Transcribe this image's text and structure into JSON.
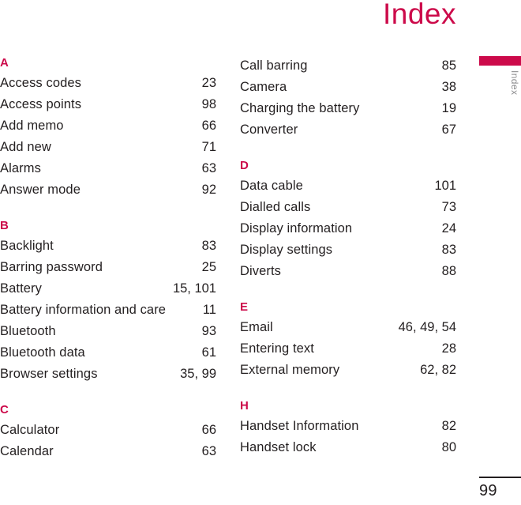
{
  "header": {
    "title": "Index"
  },
  "side_tab": {
    "label": "Index",
    "bar_color": "#cc0a4a",
    "label_color": "#8e8e90"
  },
  "footer": {
    "page_number": "99"
  },
  "theme": {
    "accent": "#cc0a4a",
    "text": "#231f20"
  },
  "columns": [
    {
      "sections": [
        {
          "letter": "A",
          "entries": [
            {
              "label": "Access codes",
              "pages": "23"
            },
            {
              "label": "Access points",
              "pages": "98"
            },
            {
              "label": "Add memo",
              "pages": "66"
            },
            {
              "label": "Add new",
              "pages": "71"
            },
            {
              "label": "Alarms",
              "pages": "63"
            },
            {
              "label": "Answer mode",
              "pages": "92"
            }
          ]
        },
        {
          "letter": "B",
          "entries": [
            {
              "label": "Backlight",
              "pages": "83"
            },
            {
              "label": "Barring password",
              "pages": "25"
            },
            {
              "label": "Battery",
              "pages": "15, 101"
            },
            {
              "label": "Battery information and care",
              "pages": "11"
            },
            {
              "label": "Bluetooth",
              "pages": "93"
            },
            {
              "label": "Bluetooth data",
              "pages": "61"
            },
            {
              "label": "Browser settings",
              "pages": "35, 99"
            }
          ]
        },
        {
          "letter": "C",
          "entries": [
            {
              "label": "Calculator",
              "pages": "66"
            },
            {
              "label": "Calendar",
              "pages": "63"
            }
          ]
        }
      ]
    },
    {
      "sections": [
        {
          "letter": "",
          "entries": [
            {
              "label": "Call barring",
              "pages": "85"
            },
            {
              "label": "Camera",
              "pages": "38"
            },
            {
              "label": "Charging the battery",
              "pages": "19"
            },
            {
              "label": "Converter",
              "pages": "67"
            }
          ]
        },
        {
          "letter": "D",
          "entries": [
            {
              "label": "Data cable",
              "pages": "101"
            },
            {
              "label": "Dialled calls",
              "pages": "73"
            },
            {
              "label": "Display information",
              "pages": "24"
            },
            {
              "label": "Display settings",
              "pages": "83"
            },
            {
              "label": "Diverts",
              "pages": "88"
            }
          ]
        },
        {
          "letter": "E",
          "entries": [
            {
              "label": "Email",
              "pages": "46, 49, 54"
            },
            {
              "label": "Entering text",
              "pages": "28"
            },
            {
              "label": "External memory",
              "pages": "62, 82"
            }
          ]
        },
        {
          "letter": "H",
          "entries": [
            {
              "label": "Handset Information",
              "pages": "82"
            },
            {
              "label": "Handset lock",
              "pages": "80"
            }
          ]
        }
      ]
    }
  ]
}
